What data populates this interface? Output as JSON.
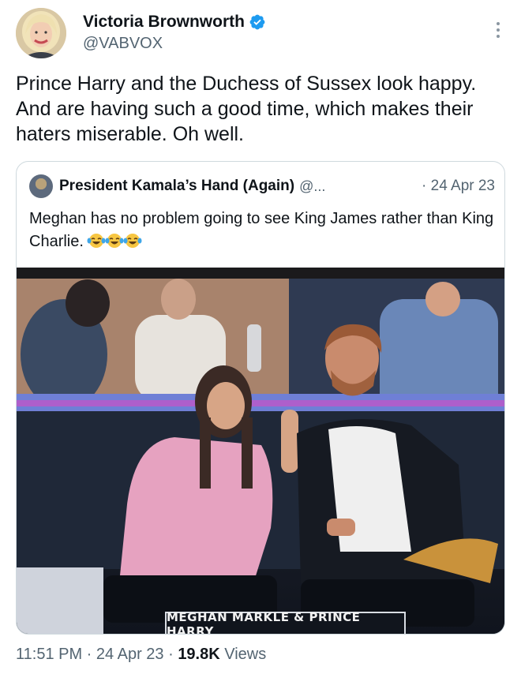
{
  "author": {
    "display_name": "Victoria Brownworth",
    "handle": "@VABVOX",
    "verified": true,
    "avatar_icon": "author-avatar"
  },
  "tweet": {
    "text": "Prince Harry and the Duchess of Sussex look happy. And are having such a good time, which makes their haters miserable. Oh well."
  },
  "quoted_tweet": {
    "display_name": "President Kamala’s Hand (Again)",
    "handle": "@...",
    "date": "· 24 Apr 23",
    "text": "Meghan has no problem  going to see King James rather than King Charlie.",
    "emoji": [
      "face-with-tears-of-joy",
      "face-with-tears-of-joy",
      "face-with-tears-of-joy"
    ],
    "media_caption": "MEGHAN MARKLE & PRINCE HARRY"
  },
  "meta": {
    "time": "11:51 PM",
    "separator": " · ",
    "date": "24 Apr 23",
    "views_count": "19.8K",
    "views_label": " Views"
  },
  "colors": {
    "text_primary": "#0f1419",
    "text_secondary": "#536471",
    "verified_blue": "#1d9bf0",
    "border": "#cfd9de"
  }
}
